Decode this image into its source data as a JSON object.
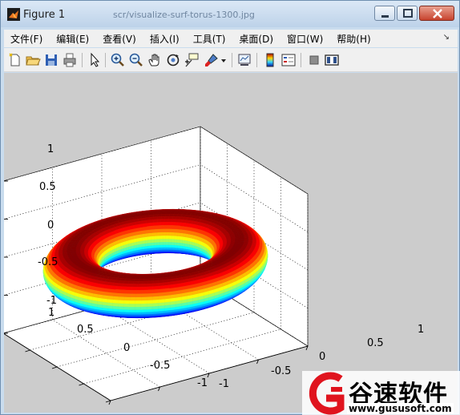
{
  "window": {
    "title": "Figure 1",
    "background_title": "scr/visualize-surf-torus-1300.jpg"
  },
  "menu": [
    "文件(F)",
    "编辑(E)",
    "查看(V)",
    "插入(I)",
    "工具(T)",
    "桌面(D)",
    "窗口(W)",
    "帮助(H)"
  ],
  "toolbar": {
    "icons": [
      "new-figure-icon",
      "open-file-icon",
      "save-icon",
      "print-icon",
      "edit-plot-icon",
      "zoom-in-icon",
      "zoom-out-icon",
      "pan-hand-icon",
      "rotate-3d-icon",
      "data-cursor-icon",
      "brush-icon",
      "dropdown-arrow-icon",
      "link-plot-icon",
      "colorbar-icon",
      "legend-icon",
      "hide-plot-tools-icon",
      "show-plot-tools-icon"
    ]
  },
  "chart_data": {
    "type": "surface",
    "surface": "torus",
    "colormap": "jet",
    "axes": {
      "x": {
        "ticks": [
          "-1",
          "-0.5",
          "0",
          "0.5",
          "1"
        ],
        "range": [
          -1,
          1
        ]
      },
      "y": {
        "ticks": [
          "-1",
          "-0.5",
          "0",
          "0.5",
          "1"
        ],
        "range": [
          -1,
          1
        ]
      },
      "z": {
        "ticks": [
          "-1",
          "-0.5",
          "0",
          "0.5",
          "1"
        ],
        "range": [
          -1,
          1
        ]
      }
    },
    "grid": true,
    "box": true
  },
  "watermark": {
    "brand": "谷速软件",
    "url": "www.gususoft.com"
  }
}
